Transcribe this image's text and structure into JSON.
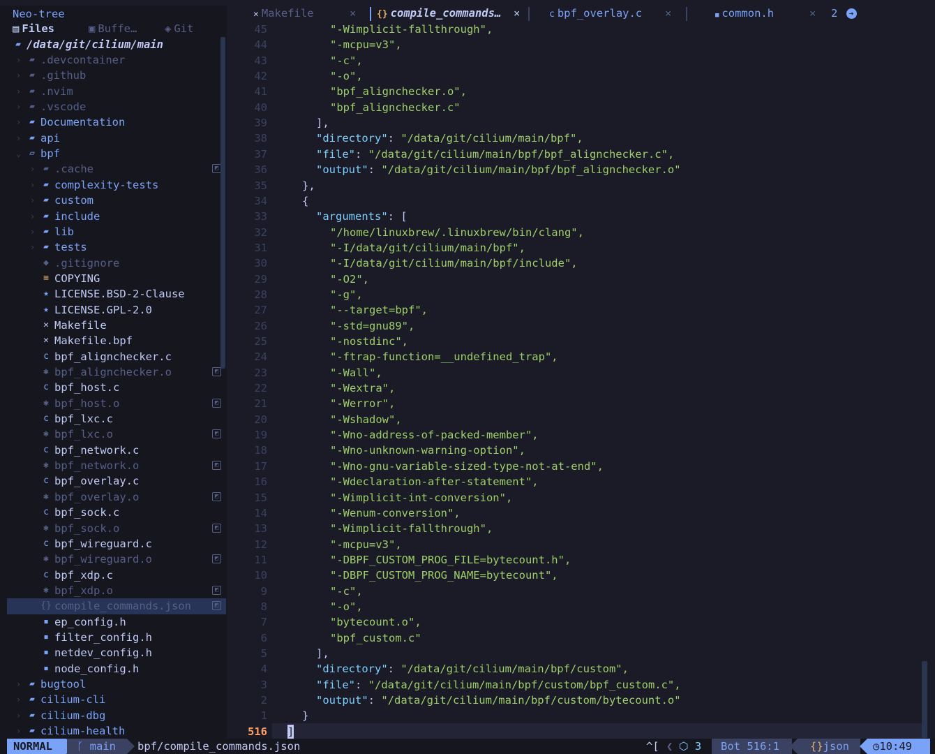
{
  "tree": {
    "title": "Neo-tree",
    "tabs": [
      {
        "icon": "files-icon",
        "label": "Files"
      },
      {
        "icon": "buffers-icon",
        "label": "Buffe…"
      },
      {
        "icon": "git-icon",
        "label": "Git"
      }
    ],
    "root": "/data/git/cilium/main",
    "items": [
      {
        "name": ".devcontainer",
        "type": "folder",
        "depth": 0,
        "expanded": false,
        "dim": true
      },
      {
        "name": ".github",
        "type": "folder",
        "depth": 0,
        "expanded": false,
        "dim": true
      },
      {
        "name": ".nvim",
        "type": "folder",
        "depth": 0,
        "expanded": false,
        "dim": true
      },
      {
        "name": ".vscode",
        "type": "folder",
        "depth": 0,
        "expanded": false,
        "dim": true
      },
      {
        "name": "Documentation",
        "type": "folder",
        "depth": 0,
        "expanded": false
      },
      {
        "name": "api",
        "type": "folder",
        "depth": 0,
        "expanded": false
      },
      {
        "name": "bpf",
        "type": "folder",
        "depth": 0,
        "expanded": true
      },
      {
        "name": ".cache",
        "type": "folder",
        "depth": 1,
        "expanded": false,
        "dim": true,
        "ignored": true
      },
      {
        "name": "complexity-tests",
        "type": "folder",
        "depth": 1,
        "expanded": false
      },
      {
        "name": "custom",
        "type": "folder",
        "depth": 1,
        "expanded": false
      },
      {
        "name": "include",
        "type": "folder",
        "depth": 1,
        "expanded": false
      },
      {
        "name": "lib",
        "type": "folder",
        "depth": 1,
        "expanded": false
      },
      {
        "name": "tests",
        "type": "folder",
        "depth": 1,
        "expanded": false
      },
      {
        "name": ".gitignore",
        "type": "gitignore",
        "depth": 1,
        "dim": true
      },
      {
        "name": "COPYING",
        "type": "text",
        "depth": 1
      },
      {
        "name": "LICENSE.BSD-2-Clause",
        "type": "license",
        "depth": 1
      },
      {
        "name": "LICENSE.GPL-2.0",
        "type": "license",
        "depth": 1
      },
      {
        "name": "Makefile",
        "type": "makefile",
        "depth": 1
      },
      {
        "name": "Makefile.bpf",
        "type": "makefile",
        "depth": 1
      },
      {
        "name": "bpf_alignchecker.c",
        "type": "c",
        "depth": 1
      },
      {
        "name": "bpf_alignchecker.o",
        "type": "object",
        "depth": 1,
        "dim": true,
        "ignored": true
      },
      {
        "name": "bpf_host.c",
        "type": "c",
        "depth": 1
      },
      {
        "name": "bpf_host.o",
        "type": "object",
        "depth": 1,
        "dim": true,
        "ignored": true
      },
      {
        "name": "bpf_lxc.c",
        "type": "c",
        "depth": 1
      },
      {
        "name": "bpf_lxc.o",
        "type": "object",
        "depth": 1,
        "dim": true,
        "ignored": true
      },
      {
        "name": "bpf_network.c",
        "type": "c",
        "depth": 1
      },
      {
        "name": "bpf_network.o",
        "type": "object",
        "depth": 1,
        "dim": true,
        "ignored": true
      },
      {
        "name": "bpf_overlay.c",
        "type": "c",
        "depth": 1
      },
      {
        "name": "bpf_overlay.o",
        "type": "object",
        "depth": 1,
        "dim": true,
        "ignored": true
      },
      {
        "name": "bpf_sock.c",
        "type": "c",
        "depth": 1
      },
      {
        "name": "bpf_sock.o",
        "type": "object",
        "depth": 1,
        "dim": true,
        "ignored": true
      },
      {
        "name": "bpf_wireguard.c",
        "type": "c",
        "depth": 1
      },
      {
        "name": "bpf_wireguard.o",
        "type": "object",
        "depth": 1,
        "dim": true,
        "ignored": true
      },
      {
        "name": "bpf_xdp.c",
        "type": "c",
        "depth": 1
      },
      {
        "name": "bpf_xdp.o",
        "type": "object",
        "depth": 1,
        "dim": true,
        "ignored": true
      },
      {
        "name": "compile_commands.json",
        "type": "json",
        "depth": 1,
        "dim": true,
        "ignored": true,
        "selected": true
      },
      {
        "name": "ep_config.h",
        "type": "h",
        "depth": 1
      },
      {
        "name": "filter_config.h",
        "type": "h",
        "depth": 1
      },
      {
        "name": "netdev_config.h",
        "type": "h",
        "depth": 1
      },
      {
        "name": "node_config.h",
        "type": "h",
        "depth": 1
      },
      {
        "name": "bugtool",
        "type": "folder",
        "depth": 0,
        "expanded": false
      },
      {
        "name": "cilium-cli",
        "type": "folder",
        "depth": 0,
        "expanded": false
      },
      {
        "name": "cilium-dbg",
        "type": "folder",
        "depth": 0,
        "expanded": false
      },
      {
        "name": "cilium-health",
        "type": "folder",
        "depth": 0,
        "expanded": false
      }
    ]
  },
  "tabs": [
    {
      "icon": "makefile-icon",
      "label": "Makefile",
      "active": false
    },
    {
      "icon": "json-icon",
      "label": "compile_commands…",
      "active": true
    },
    {
      "icon": "c-file-icon",
      "label": "bpf_overlay.c",
      "active": false
    },
    {
      "icon": "header-file-icon",
      "label": "common.h",
      "active": false
    }
  ],
  "tab_overflow": "2",
  "editor": {
    "lines": [
      {
        "n": "45",
        "indent": 3,
        "text": "\"-Wimplicit-fallthrough\",",
        "kind": "str"
      },
      {
        "n": "44",
        "indent": 3,
        "text": "\"-mcpu=v3\",",
        "kind": "str"
      },
      {
        "n": "43",
        "indent": 3,
        "text": "\"-c\",",
        "kind": "str"
      },
      {
        "n": "42",
        "indent": 3,
        "text": "\"-o\",",
        "kind": "str"
      },
      {
        "n": "41",
        "indent": 3,
        "text": "\"bpf_alignchecker.o\",",
        "kind": "str"
      },
      {
        "n": "40",
        "indent": 3,
        "text": "\"bpf_alignchecker.c\"",
        "kind": "str"
      },
      {
        "n": "39",
        "indent": 2,
        "text": "],",
        "kind": "punct"
      },
      {
        "n": "38",
        "indent": 2,
        "key": "\"directory\"",
        "text": "\"/data/git/cilium/main/bpf\",",
        "kind": "kv"
      },
      {
        "n": "37",
        "indent": 2,
        "key": "\"file\"",
        "text": "\"/data/git/cilium/main/bpf/bpf_alignchecker.c\",",
        "kind": "kv"
      },
      {
        "n": "36",
        "indent": 2,
        "key": "\"output\"",
        "text": "\"/data/git/cilium/main/bpf/bpf_alignchecker.o\"",
        "kind": "kv"
      },
      {
        "n": "35",
        "indent": 1,
        "text": "},",
        "kind": "punct"
      },
      {
        "n": "34",
        "indent": 1,
        "text": "{",
        "kind": "punct"
      },
      {
        "n": "33",
        "indent": 2,
        "key": "\"arguments\"",
        "text": "[",
        "kind": "kvp"
      },
      {
        "n": "32",
        "indent": 3,
        "text": "\"/home/linuxbrew/.linuxbrew/bin/clang\",",
        "kind": "str"
      },
      {
        "n": "31",
        "indent": 3,
        "text": "\"-I/data/git/cilium/main/bpf\",",
        "kind": "str"
      },
      {
        "n": "30",
        "indent": 3,
        "text": "\"-I/data/git/cilium/main/bpf/include\",",
        "kind": "str"
      },
      {
        "n": "29",
        "indent": 3,
        "text": "\"-O2\",",
        "kind": "str"
      },
      {
        "n": "28",
        "indent": 3,
        "text": "\"-g\",",
        "kind": "str"
      },
      {
        "n": "27",
        "indent": 3,
        "text": "\"--target=bpf\",",
        "kind": "str"
      },
      {
        "n": "26",
        "indent": 3,
        "text": "\"-std=gnu89\",",
        "kind": "str"
      },
      {
        "n": "25",
        "indent": 3,
        "text": "\"-nostdinc\",",
        "kind": "str"
      },
      {
        "n": "24",
        "indent": 3,
        "text": "\"-ftrap-function=__undefined_trap\",",
        "kind": "str"
      },
      {
        "n": "23",
        "indent": 3,
        "text": "\"-Wall\",",
        "kind": "str"
      },
      {
        "n": "22",
        "indent": 3,
        "text": "\"-Wextra\",",
        "kind": "str"
      },
      {
        "n": "21",
        "indent": 3,
        "text": "\"-Werror\",",
        "kind": "str"
      },
      {
        "n": "20",
        "indent": 3,
        "text": "\"-Wshadow\",",
        "kind": "str"
      },
      {
        "n": "19",
        "indent": 3,
        "text": "\"-Wno-address-of-packed-member\",",
        "kind": "str"
      },
      {
        "n": "18",
        "indent": 3,
        "text": "\"-Wno-unknown-warning-option\",",
        "kind": "str"
      },
      {
        "n": "17",
        "indent": 3,
        "text": "\"-Wno-gnu-variable-sized-type-not-at-end\",",
        "kind": "str"
      },
      {
        "n": "16",
        "indent": 3,
        "text": "\"-Wdeclaration-after-statement\",",
        "kind": "str"
      },
      {
        "n": "15",
        "indent": 3,
        "text": "\"-Wimplicit-int-conversion\",",
        "kind": "str"
      },
      {
        "n": "14",
        "indent": 3,
        "text": "\"-Wenum-conversion\",",
        "kind": "str"
      },
      {
        "n": "13",
        "indent": 3,
        "text": "\"-Wimplicit-fallthrough\",",
        "kind": "str"
      },
      {
        "n": "12",
        "indent": 3,
        "text": "\"-mcpu=v3\",",
        "kind": "str"
      },
      {
        "n": "11",
        "indent": 3,
        "text": "\"-DBPF_CUSTOM_PROG_FILE=bytecount.h\",",
        "kind": "str"
      },
      {
        "n": "10",
        "indent": 3,
        "text": "\"-DBPF_CUSTOM_PROG_NAME=bytecount\",",
        "kind": "str"
      },
      {
        "n": "9",
        "indent": 3,
        "text": "\"-c\",",
        "kind": "str"
      },
      {
        "n": "8",
        "indent": 3,
        "text": "\"-o\",",
        "kind": "str"
      },
      {
        "n": "7",
        "indent": 3,
        "text": "\"bytecount.o\",",
        "kind": "str"
      },
      {
        "n": "6",
        "indent": 3,
        "text": "\"bpf_custom.c\"",
        "kind": "str"
      },
      {
        "n": "5",
        "indent": 2,
        "text": "],",
        "kind": "punct"
      },
      {
        "n": "4",
        "indent": 2,
        "key": "\"directory\"",
        "text": "\"/data/git/cilium/main/bpf/custom\",",
        "kind": "kv"
      },
      {
        "n": "3",
        "indent": 2,
        "key": "\"file\"",
        "text": "\"/data/git/cilium/main/bpf/custom/bpf_custom.c\",",
        "kind": "kv"
      },
      {
        "n": "2",
        "indent": 2,
        "key": "\"output\"",
        "text": "\"/data/git/cilium/main/bpf/custom/bytecount.o\"",
        "kind": "kv"
      },
      {
        "n": "1",
        "indent": 1,
        "text": "}",
        "kind": "punct"
      },
      {
        "n": "516",
        "indent": 0,
        "text": "]",
        "kind": "cursor",
        "current": true
      }
    ]
  },
  "statusline": {
    "mode": "NORMAL",
    "branch_icon": "git-branch-icon",
    "branch": "main",
    "file": "bpf/compile_commands.json",
    "keys": "^[",
    "lsp_icon": "lsp-cube-icon",
    "lsp_count": "3",
    "position_label": "Bot",
    "position": "516:1",
    "filetype_icon": "json-icon",
    "filetype": "json",
    "clock_icon": "clock-icon",
    "time": "10:49"
  },
  "colors": {
    "bg": "#1a1b26",
    "sidebar_bg": "#16161e",
    "accent": "#7aa2f7",
    "string": "#9ece6a",
    "key": "#7dcfff",
    "line_nr_current": "#ff9e64",
    "dim": "#565f89"
  }
}
